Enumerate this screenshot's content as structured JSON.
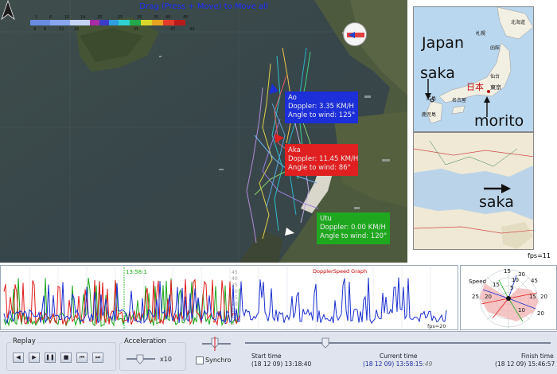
{
  "map": {
    "drag_hint": "Drag (Press + Move) to Move all",
    "legend_values_top": [
      "2",
      "6",
      "10",
      "14",
      "20",
      "25",
      "30",
      "35",
      "40",
      "45"
    ],
    "legend_values_bottom": [
      "4",
      "8",
      "12",
      "16",
      "25",
      "47",
      "43"
    ]
  },
  "boats": [
    {
      "name": "Ao",
      "doppler": "Doppler: 3.35 KM/H",
      "angle": "Angle to wind: 125°",
      "color": "#1c2fd9"
    },
    {
      "name": "Aka",
      "doppler": "Doppler: 11.45 KM/H",
      "angle": "Angle to wind: 86°",
      "color": "#e02020"
    },
    {
      "name": "Utu",
      "doppler": "Doppler: 0.00 KM/H",
      "angle": "Angle to wind: 120°",
      "color": "#1fa81f"
    }
  ],
  "inset_maps": {
    "japan_label": "Japan",
    "saka_label": "saka",
    "morito_label": "morito",
    "detail_saka_label": "saka",
    "kanji_nihon": "日本",
    "kanji_tokyo": "東京",
    "kanji_sapporo": "札幌",
    "kanji_hokkaido": "北海道",
    "kanji_sendai": "仙台",
    "kanji_nagoya": "名古屋",
    "kanji_hiroshima": "広島",
    "kanji_kagoshima": "鹿児島",
    "kanji_hakodate": "函館"
  },
  "fps": "fps=11",
  "graph": {
    "title": "DopplerSpeed Graph",
    "cursor_time": "13:58:1",
    "scale_labels": [
      "45",
      "40",
      "35",
      "30",
      "25",
      "20",
      "15",
      "10",
      "5"
    ],
    "fps_label": "fps=20"
  },
  "rose": {
    "speed_label": "Speed",
    "labels": [
      "15",
      "30",
      "45",
      "10",
      "5",
      "25",
      "20",
      "15",
      "10",
      "20",
      "20",
      "15"
    ]
  },
  "controls": {
    "replay_title": "Replay",
    "acceleration_title": "Acceleration",
    "accel_value": "x10",
    "synchro_label": "Synchro",
    "start_time_label": "Start time",
    "start_time_value": "(18 12 09) 13:18:40",
    "current_time_label": "Current time",
    "current_time_value": "(18 12 09) 13:58:15",
    "current_time_frac": ":49",
    "finish_time_label": "Finish time",
    "finish_time_value": "(18 12 09) 15:46:57",
    "replay_buttons": [
      "◀",
      "▶",
      "❚❚",
      "■",
      "⏮",
      "⏭"
    ]
  }
}
